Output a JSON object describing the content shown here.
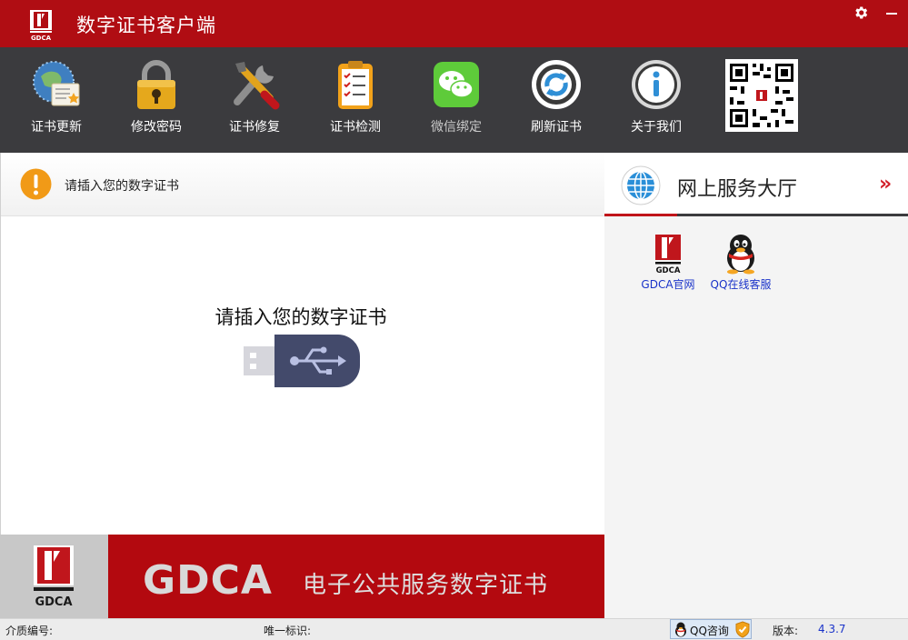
{
  "window": {
    "title": "数字证书客户端"
  },
  "toolbar": {
    "items": [
      {
        "label": "证书更新",
        "icon": "certificate-update-icon"
      },
      {
        "label": "修改密码",
        "icon": "padlock-icon"
      },
      {
        "label": "证书修复",
        "icon": "tools-repair-icon"
      },
      {
        "label": "证书检测",
        "icon": "clipboard-checklist-icon"
      },
      {
        "label": "微信绑定",
        "icon": "wechat-icon"
      },
      {
        "label": "刷新证书",
        "icon": "refresh-icon"
      },
      {
        "label": "关于我们",
        "icon": "info-icon"
      }
    ],
    "qr_icon": "qr-code"
  },
  "notice": {
    "text": "请插入您的数字证书"
  },
  "main": {
    "prompt": "请插入您的数字证书"
  },
  "banner": {
    "brand": "GDCA",
    "slogan": "电子公共服务数字证书",
    "logo_text": "GDCA"
  },
  "hall": {
    "title": "网上服务大厅",
    "more": "»",
    "services": [
      {
        "label": "GDCA官网",
        "icon": "gdca-logo-icon"
      },
      {
        "label": "QQ在线客服",
        "icon": "qq-penguin-icon"
      }
    ]
  },
  "status": {
    "media_label": "介质编号:",
    "uid_label": "唯一标识:",
    "qq_button": "QQ咨询",
    "version_label": "版本:",
    "version": "4.3.7"
  },
  "colors": {
    "brand_red": "#b00d13",
    "toolbar_dark": "#3b3b3e",
    "link_blue": "#1a33c9"
  }
}
